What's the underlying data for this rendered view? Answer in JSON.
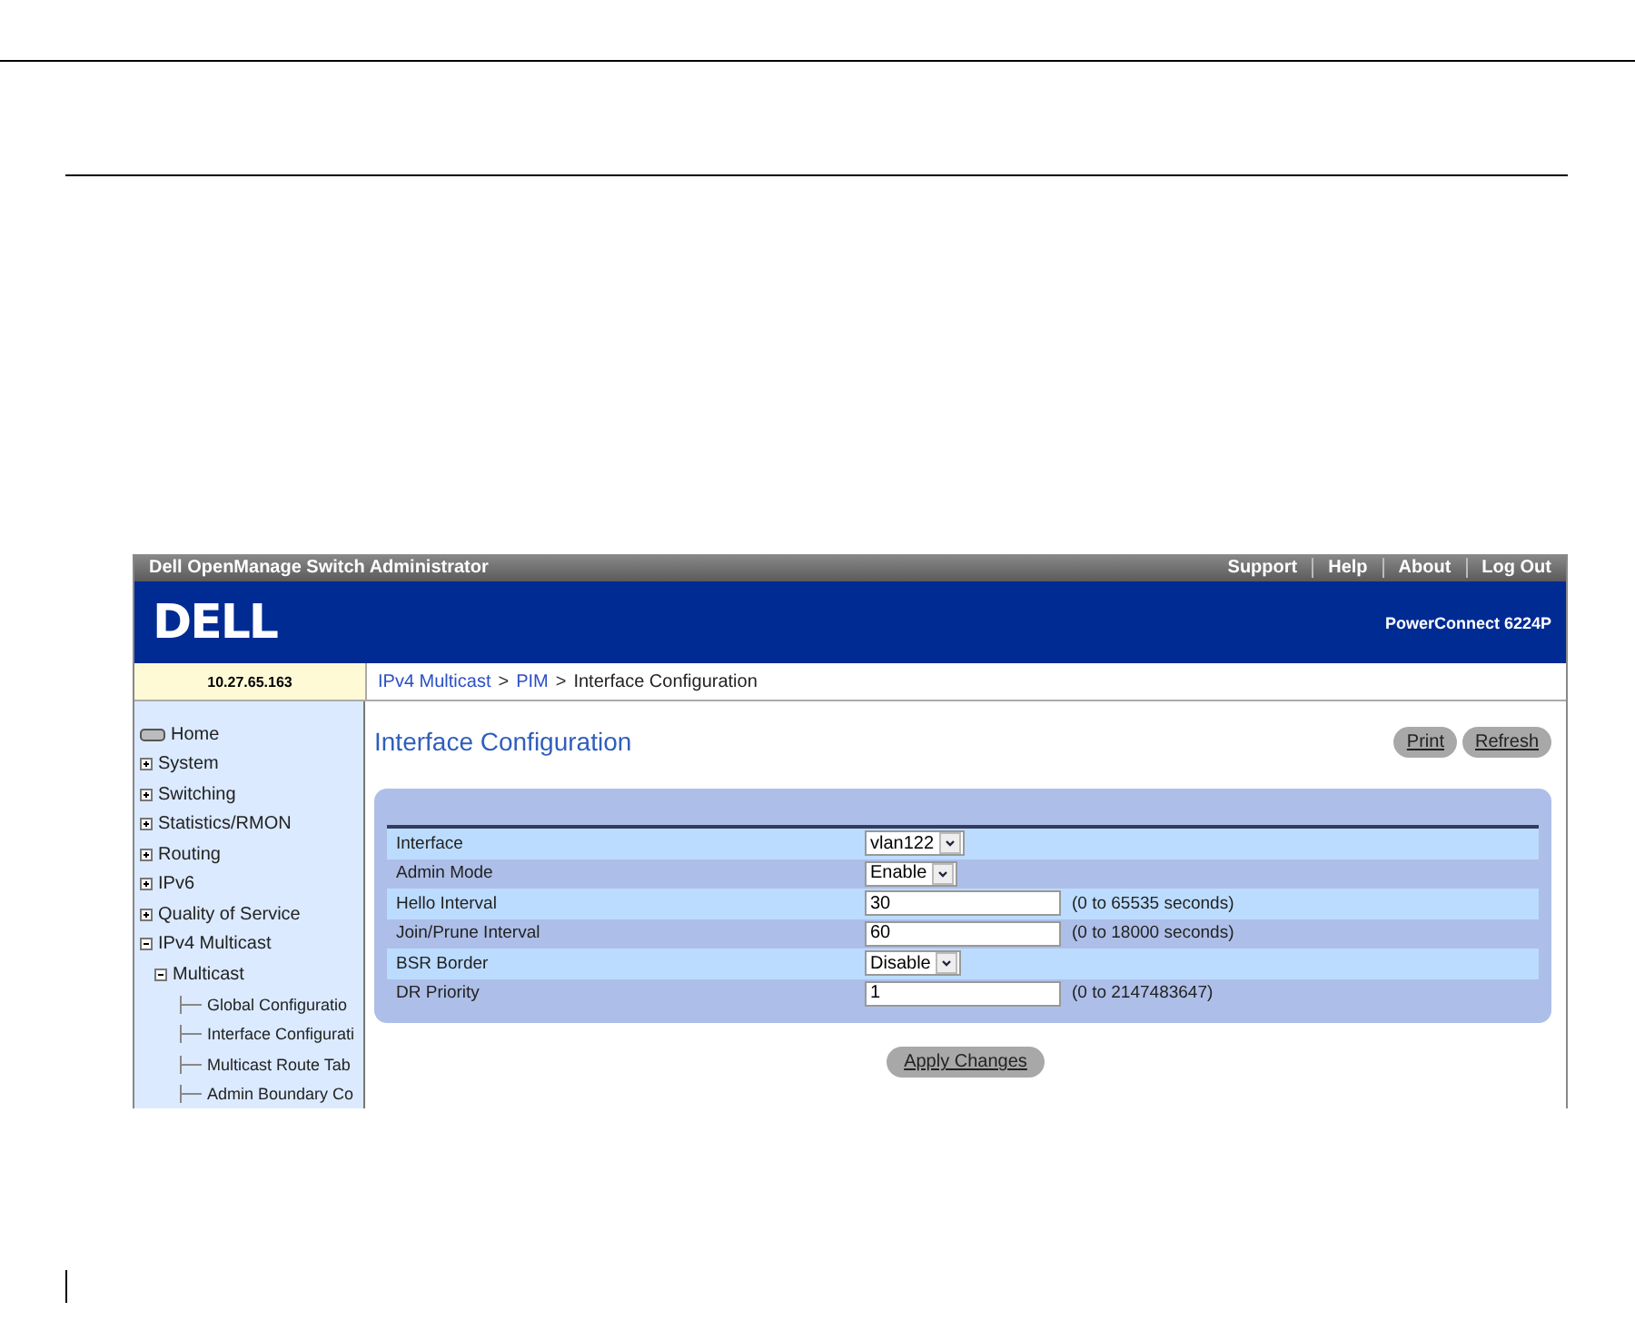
{
  "app": {
    "title": "Dell OpenManage Switch Administrator",
    "links": [
      "Support",
      "Help",
      "About",
      "Log Out"
    ],
    "logo": "DELL",
    "product": "PowerConnect 6224P",
    "address": "10.27.65.163"
  },
  "breadcrumb": [
    "IPv4 Multicast",
    "PIM",
    "Interface Configuration"
  ],
  "breadcrumb_separator": ">",
  "sidebar": {
    "items": [
      {
        "label": "Home",
        "kind": "home"
      },
      {
        "label": "System",
        "kind": "folder",
        "expanded": false
      },
      {
        "label": "Switching",
        "kind": "folder",
        "expanded": false
      },
      {
        "label": "Statistics/RMON",
        "kind": "folder",
        "expanded": false
      },
      {
        "label": "Routing",
        "kind": "folder",
        "expanded": false
      },
      {
        "label": "IPv6",
        "kind": "folder",
        "expanded": false
      },
      {
        "label": "Quality of Service",
        "kind": "folder",
        "expanded": false
      },
      {
        "label": "IPv4 Multicast",
        "kind": "folder",
        "expanded": true,
        "children": [
          {
            "label": "Multicast",
            "kind": "folder",
            "expanded": true,
            "children": [
              {
                "label": "Global Configuratio",
                "kind": "leaf"
              },
              {
                "label": "Interface Configurati",
                "kind": "leaf"
              },
              {
                "label": "Multicast Route Tab",
                "kind": "leaf"
              },
              {
                "label": "Admin Boundary Co",
                "kind": "leaf"
              }
            ]
          }
        ]
      }
    ]
  },
  "page": {
    "title": "Interface Configuration",
    "buttons": [
      "Print",
      "Refresh"
    ],
    "fields": [
      {
        "label": "Interface",
        "kind": "select",
        "value": "vlan122"
      },
      {
        "label": "Admin Mode",
        "kind": "select",
        "value": "Enable"
      },
      {
        "label": "Hello Interval",
        "kind": "text",
        "value": "30",
        "hint": "(0 to 65535 seconds)"
      },
      {
        "label": "Join/Prune Interval",
        "kind": "text",
        "value": "60",
        "hint": "(0 to 18000 seconds)"
      },
      {
        "label": "BSR Border",
        "kind": "select",
        "value": "Disable"
      },
      {
        "label": "DR Priority",
        "kind": "text",
        "value": "1",
        "hint": "(0 to 2147483647)"
      }
    ],
    "apply": "Apply Changes"
  }
}
